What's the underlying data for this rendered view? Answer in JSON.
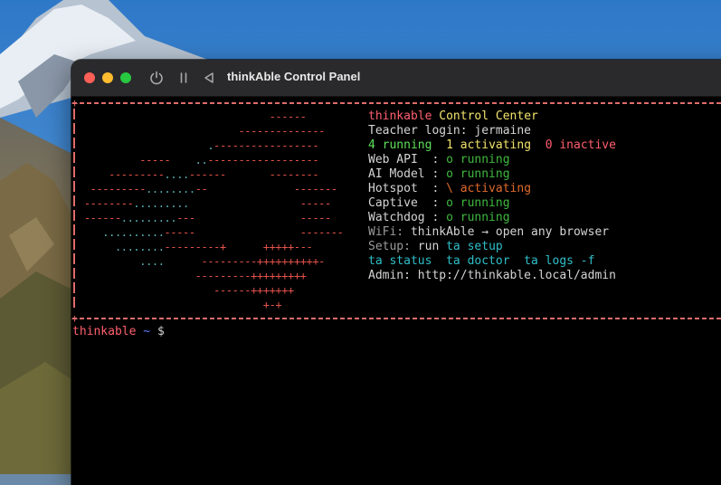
{
  "window": {
    "title": "thinkAble Control Panel"
  },
  "icons": {
    "power": "power-icon",
    "pause": "pause-icon",
    "back": "back-triangle-icon"
  },
  "banner": {
    "title_a": "thinkable",
    "title_b": "Control Center",
    "teacher_login": "Teacher login: jermaine",
    "counts": {
      "running": "4 running",
      "activating": "1 activating",
      "inactive": "0 inactive"
    },
    "services": [
      {
        "label": "Web API  : ",
        "glyph": "o",
        "state": "running"
      },
      {
        "label": "AI Model : ",
        "glyph": "o",
        "state": "running"
      },
      {
        "label": "Hotspot  : ",
        "glyph": "\\",
        "state": "activating"
      },
      {
        "label": "Captive  : ",
        "glyph": "o",
        "state": "running"
      },
      {
        "label": "Watchdog : ",
        "glyph": "o",
        "state": "running"
      }
    ],
    "wifi_label": "WiFi:",
    "wifi_value": " thinkAble → open any browser",
    "setup_label": "Setup:",
    "setup_value": " run ",
    "setup_cmd": "ta setup",
    "commands": "ta status  ta doctor  ta logs -f",
    "admin": "Admin: http://thinkable.local/admin"
  },
  "prompt": {
    "host": "thinkable",
    "path": "~",
    "symbol": "$"
  },
  "colors": {
    "accent_red": "#e5534b",
    "teal": "#5ab4b8",
    "running_green": "#3fb83f",
    "activating_orange": "#e06a2c",
    "cyan": "#2fbfc9"
  }
}
